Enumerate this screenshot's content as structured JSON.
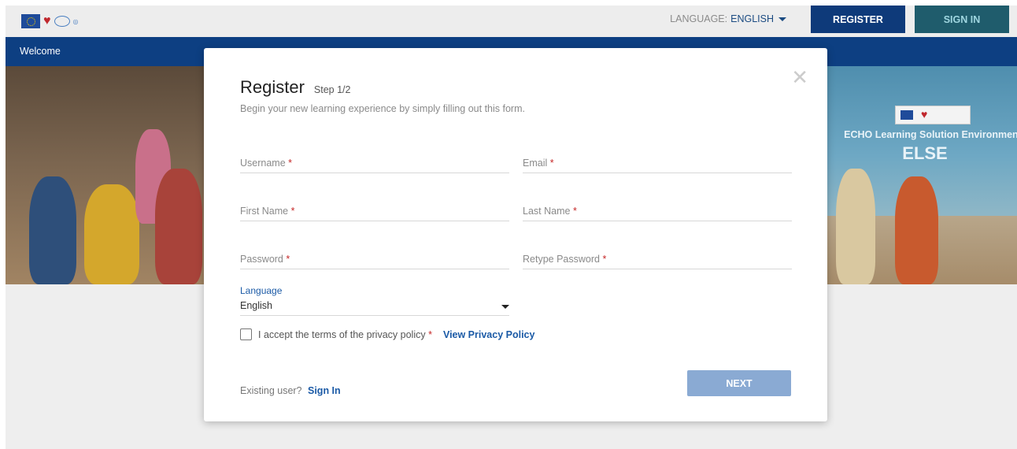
{
  "topbar": {
    "language_label": "LANGUAGE:",
    "language_value": "ENGLISH",
    "register_label": "REGISTER",
    "signin_label": "SIGN IN"
  },
  "nav": {
    "welcome": "Welcome"
  },
  "hero": {
    "subtitle": "ECHO Learning Solution Environment",
    "title": "ELSE"
  },
  "modal": {
    "title": "Register",
    "step": "Step 1/2",
    "subtitle": "Begin your new learning experience by simply filling out this form.",
    "close_icon": "close-icon",
    "fields": {
      "username": "Username",
      "email": "Email",
      "first_name": "First Name",
      "last_name": "Last Name",
      "password": "Password",
      "retype_password": "Retype Password",
      "required_mark": "*"
    },
    "language": {
      "label": "Language",
      "value": "English"
    },
    "terms": {
      "text": "I accept the terms of the privacy policy",
      "link": "View Privacy Policy"
    },
    "existing_user": "Existing user?",
    "signin_link": "Sign In",
    "next_label": "NEXT"
  },
  "colors": {
    "primary": "#0e3a7a",
    "secondary": "#1f5c6c",
    "link": "#1b5aa6",
    "next_disabled": "#8aaad3",
    "required": "#c62828"
  }
}
